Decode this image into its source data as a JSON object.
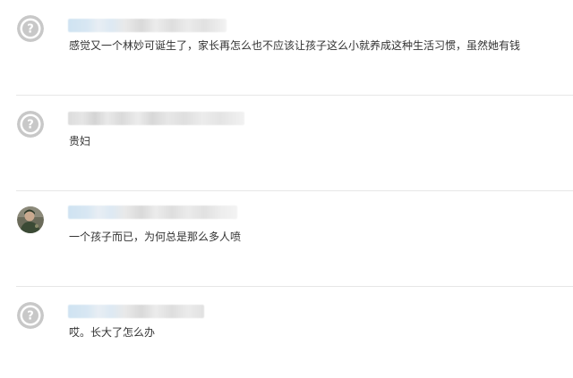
{
  "comments": [
    {
      "avatar_icon": "default-avatar-icon",
      "username": "",
      "text": "感觉又一个林妙可诞生了，家长再怎么也不应该让孩子这么小就养成这种生活习惯，虽然她有钱"
    },
    {
      "avatar_icon": "default-avatar-icon",
      "username": "",
      "text": "贵妇"
    },
    {
      "avatar_icon": "user-photo-avatar",
      "username": "",
      "text": "一个孩子而已，为何总是那么多人喷"
    },
    {
      "avatar_icon": "default-avatar-icon",
      "username": "",
      "text": "哎。长大了怎么办"
    }
  ],
  "colors": {
    "text": "#333333",
    "divider": "#e6e6e6",
    "default_avatar": "#c8c8c8"
  }
}
